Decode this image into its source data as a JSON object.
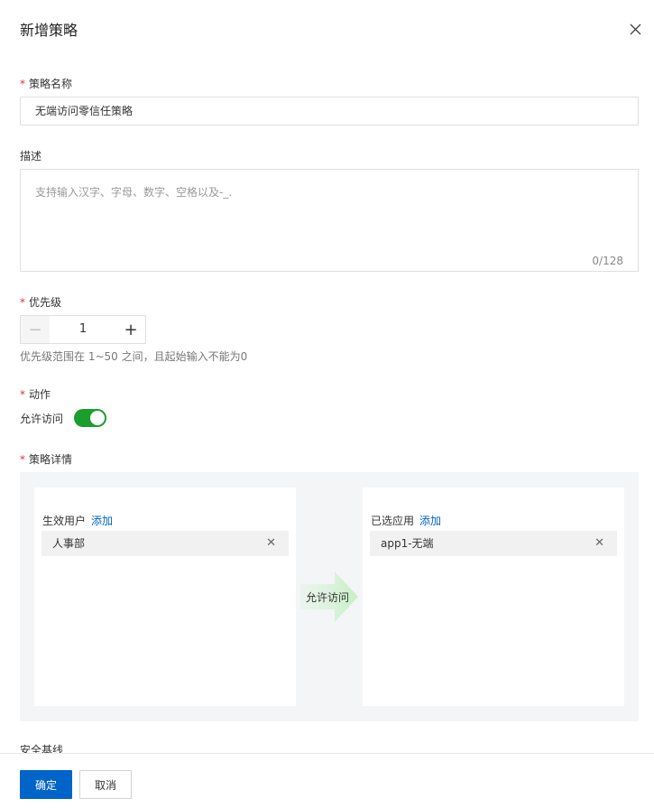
{
  "dialog": {
    "title": "新增策略",
    "close_icon": "close-icon"
  },
  "form": {
    "name": {
      "label": "策略名称",
      "required": true,
      "value": "无端访问零信任策略"
    },
    "description": {
      "label": "描述",
      "placeholder": "支持输入汉字、字母、数字、空格以及-_.",
      "counter": "0/128"
    },
    "priority": {
      "label": "优先级",
      "required": true,
      "value": "1",
      "minus": "−",
      "plus": "+",
      "hint": "优先级范围在 1~50 之间，且起始输入不能为0"
    },
    "action": {
      "label": "动作",
      "required": true,
      "toggle_label": "允许访问",
      "toggle_on": true,
      "toggle_color": "#1a9e2e"
    },
    "details": {
      "label": "策略详情",
      "required": true,
      "left_panel": {
        "title": "生效用户",
        "add": "添加",
        "items": [
          {
            "label": "人事部",
            "remove": "✕"
          }
        ]
      },
      "arrow_label": "允许访问",
      "right_panel": {
        "title": "已选应用",
        "add": "添加",
        "items": [
          {
            "label": "app1-无端",
            "remove": "✕"
          }
        ]
      }
    },
    "next_section": "安全基线"
  },
  "footer": {
    "confirm": "确定",
    "cancel": "取消",
    "primary_color": "#0064c8"
  }
}
